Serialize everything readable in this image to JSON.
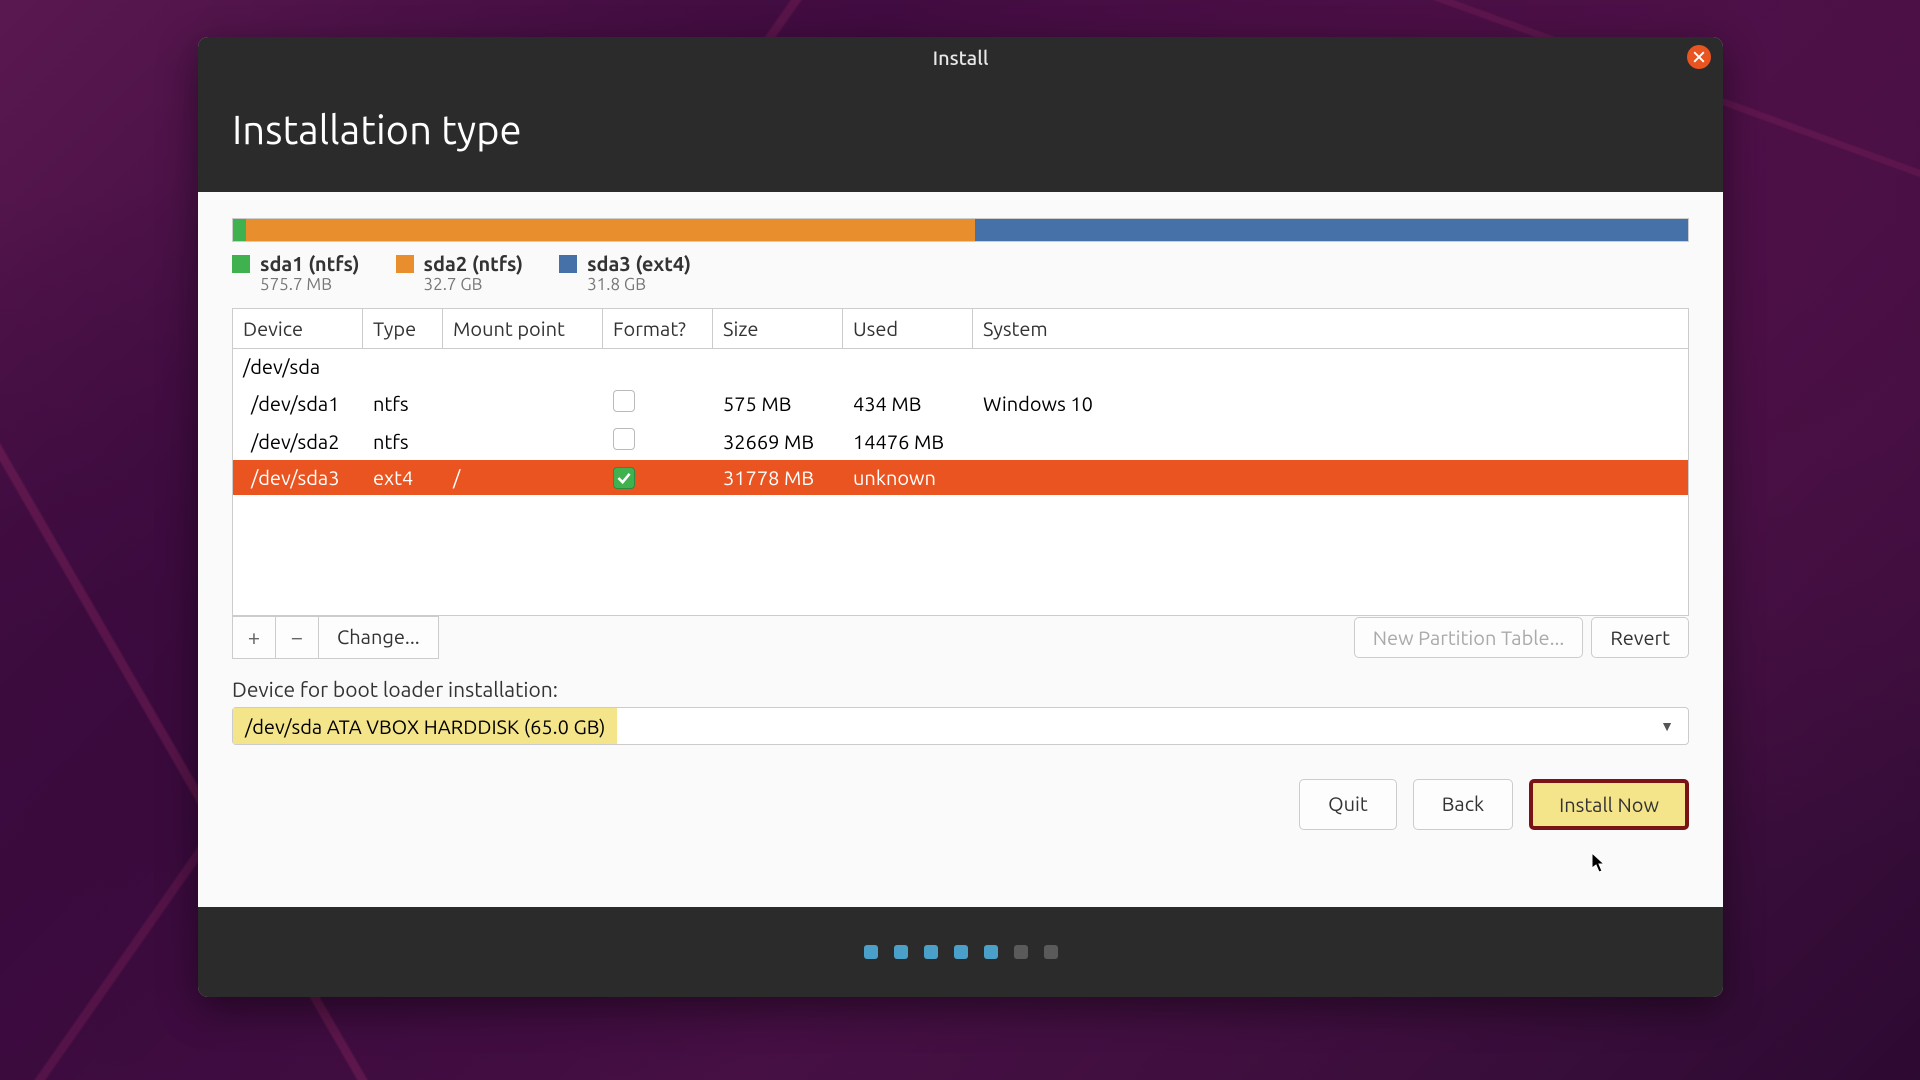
{
  "window_title": "Install",
  "page_title": "Installation type",
  "disk_segments": [
    {
      "color": "green",
      "pct": 0.9
    },
    {
      "color": "orange",
      "pct": 50.1
    },
    {
      "color": "blue",
      "pct": 49.0
    }
  ],
  "legend": [
    {
      "color": "#3fb24f",
      "name": "sda1 (ntfs)",
      "size": "575.7 MB"
    },
    {
      "color": "#e98e2c",
      "name": "sda2 (ntfs)",
      "size": "32.7 GB"
    },
    {
      "color": "#4571a8",
      "name": "sda3 (ext4)",
      "size": "31.8 GB"
    }
  ],
  "columns": {
    "device": "Device",
    "type": "Type",
    "mount": "Mount point",
    "format": "Format?",
    "size": "Size",
    "used": "Used",
    "system": "System"
  },
  "disk_row": "/dev/sda",
  "partitions": [
    {
      "device": "/dev/sda1",
      "type": "ntfs",
      "mount": "",
      "format": false,
      "size": "575 MB",
      "used": "434 MB",
      "system": "Windows 10",
      "selected": false
    },
    {
      "device": "/dev/sda2",
      "type": "ntfs",
      "mount": "",
      "format": false,
      "size": "32669 MB",
      "used": "14476 MB",
      "system": "",
      "selected": false
    },
    {
      "device": "/dev/sda3",
      "type": "ext4",
      "mount": "/",
      "format": true,
      "size": "31778 MB",
      "used": "unknown",
      "system": "",
      "selected": true
    }
  ],
  "toolbar": {
    "add": "+",
    "remove": "−",
    "change": "Change...",
    "new_table": "New Partition Table...",
    "revert": "Revert"
  },
  "bootloader_label": "Device for boot loader installation:",
  "bootloader_value": "/dev/sda   ATA VBOX HARDDISK (65.0 GB)",
  "nav": {
    "quit": "Quit",
    "back": "Back",
    "install": "Install Now"
  },
  "progress_dots": {
    "active": 5,
    "total": 7
  }
}
